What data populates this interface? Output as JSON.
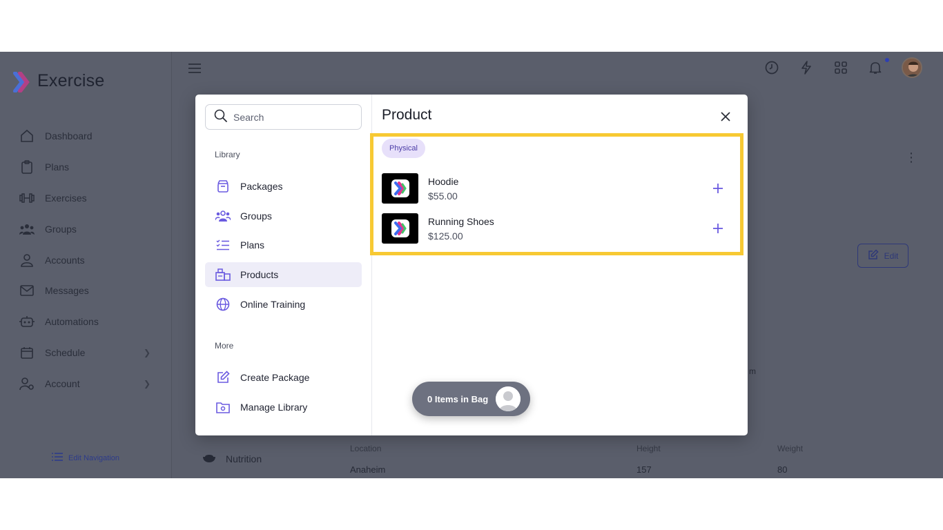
{
  "app": {
    "name": "Exercise"
  },
  "sidebar": {
    "items": [
      {
        "label": "Dashboard",
        "icon": "home-icon"
      },
      {
        "label": "Plans",
        "icon": "clipboard-icon"
      },
      {
        "label": "Exercises",
        "icon": "dumbbell-icon"
      },
      {
        "label": "Groups",
        "icon": "users-icon"
      },
      {
        "label": "Accounts",
        "icon": "user-icon"
      },
      {
        "label": "Messages",
        "icon": "mail-icon"
      },
      {
        "label": "Automations",
        "icon": "robot-icon"
      },
      {
        "label": "Schedule",
        "icon": "calendar-icon"
      },
      {
        "label": "Account",
        "icon": "user-gear-icon"
      }
    ],
    "edit_navigation": "Edit Navigation"
  },
  "background": {
    "edit_label": "Edit",
    "nutrition_label": "Nutrition",
    "partial_m": "m",
    "table": {
      "headers": [
        "Location",
        "Height",
        "Weight"
      ],
      "values": [
        "Anaheim",
        "157",
        "80"
      ]
    }
  },
  "modal": {
    "search_placeholder": "Search",
    "library_label": "Library",
    "library_items": [
      {
        "label": "Packages",
        "icon": "package-icon"
      },
      {
        "label": "Groups",
        "icon": "users-icon"
      },
      {
        "label": "Plans",
        "icon": "checklist-icon"
      },
      {
        "label": "Products",
        "icon": "products-icon",
        "active": true
      },
      {
        "label": "Online Training",
        "icon": "globe-icon"
      }
    ],
    "more_label": "More",
    "more_items": [
      {
        "label": "Create Package",
        "icon": "edit-icon"
      },
      {
        "label": "Manage Library",
        "icon": "folder-gear-icon"
      }
    ],
    "title": "Product",
    "filter_chip": "Physical",
    "products": [
      {
        "name": "Hoodie",
        "price": "$55.00"
      },
      {
        "name": "Running Shoes",
        "price": "$125.00"
      }
    ],
    "bag_label": "0 Items in Bag"
  },
  "colors": {
    "accent": "#6a5ae0",
    "highlight": "#f7c933",
    "overlay": "#5a5e6b"
  }
}
